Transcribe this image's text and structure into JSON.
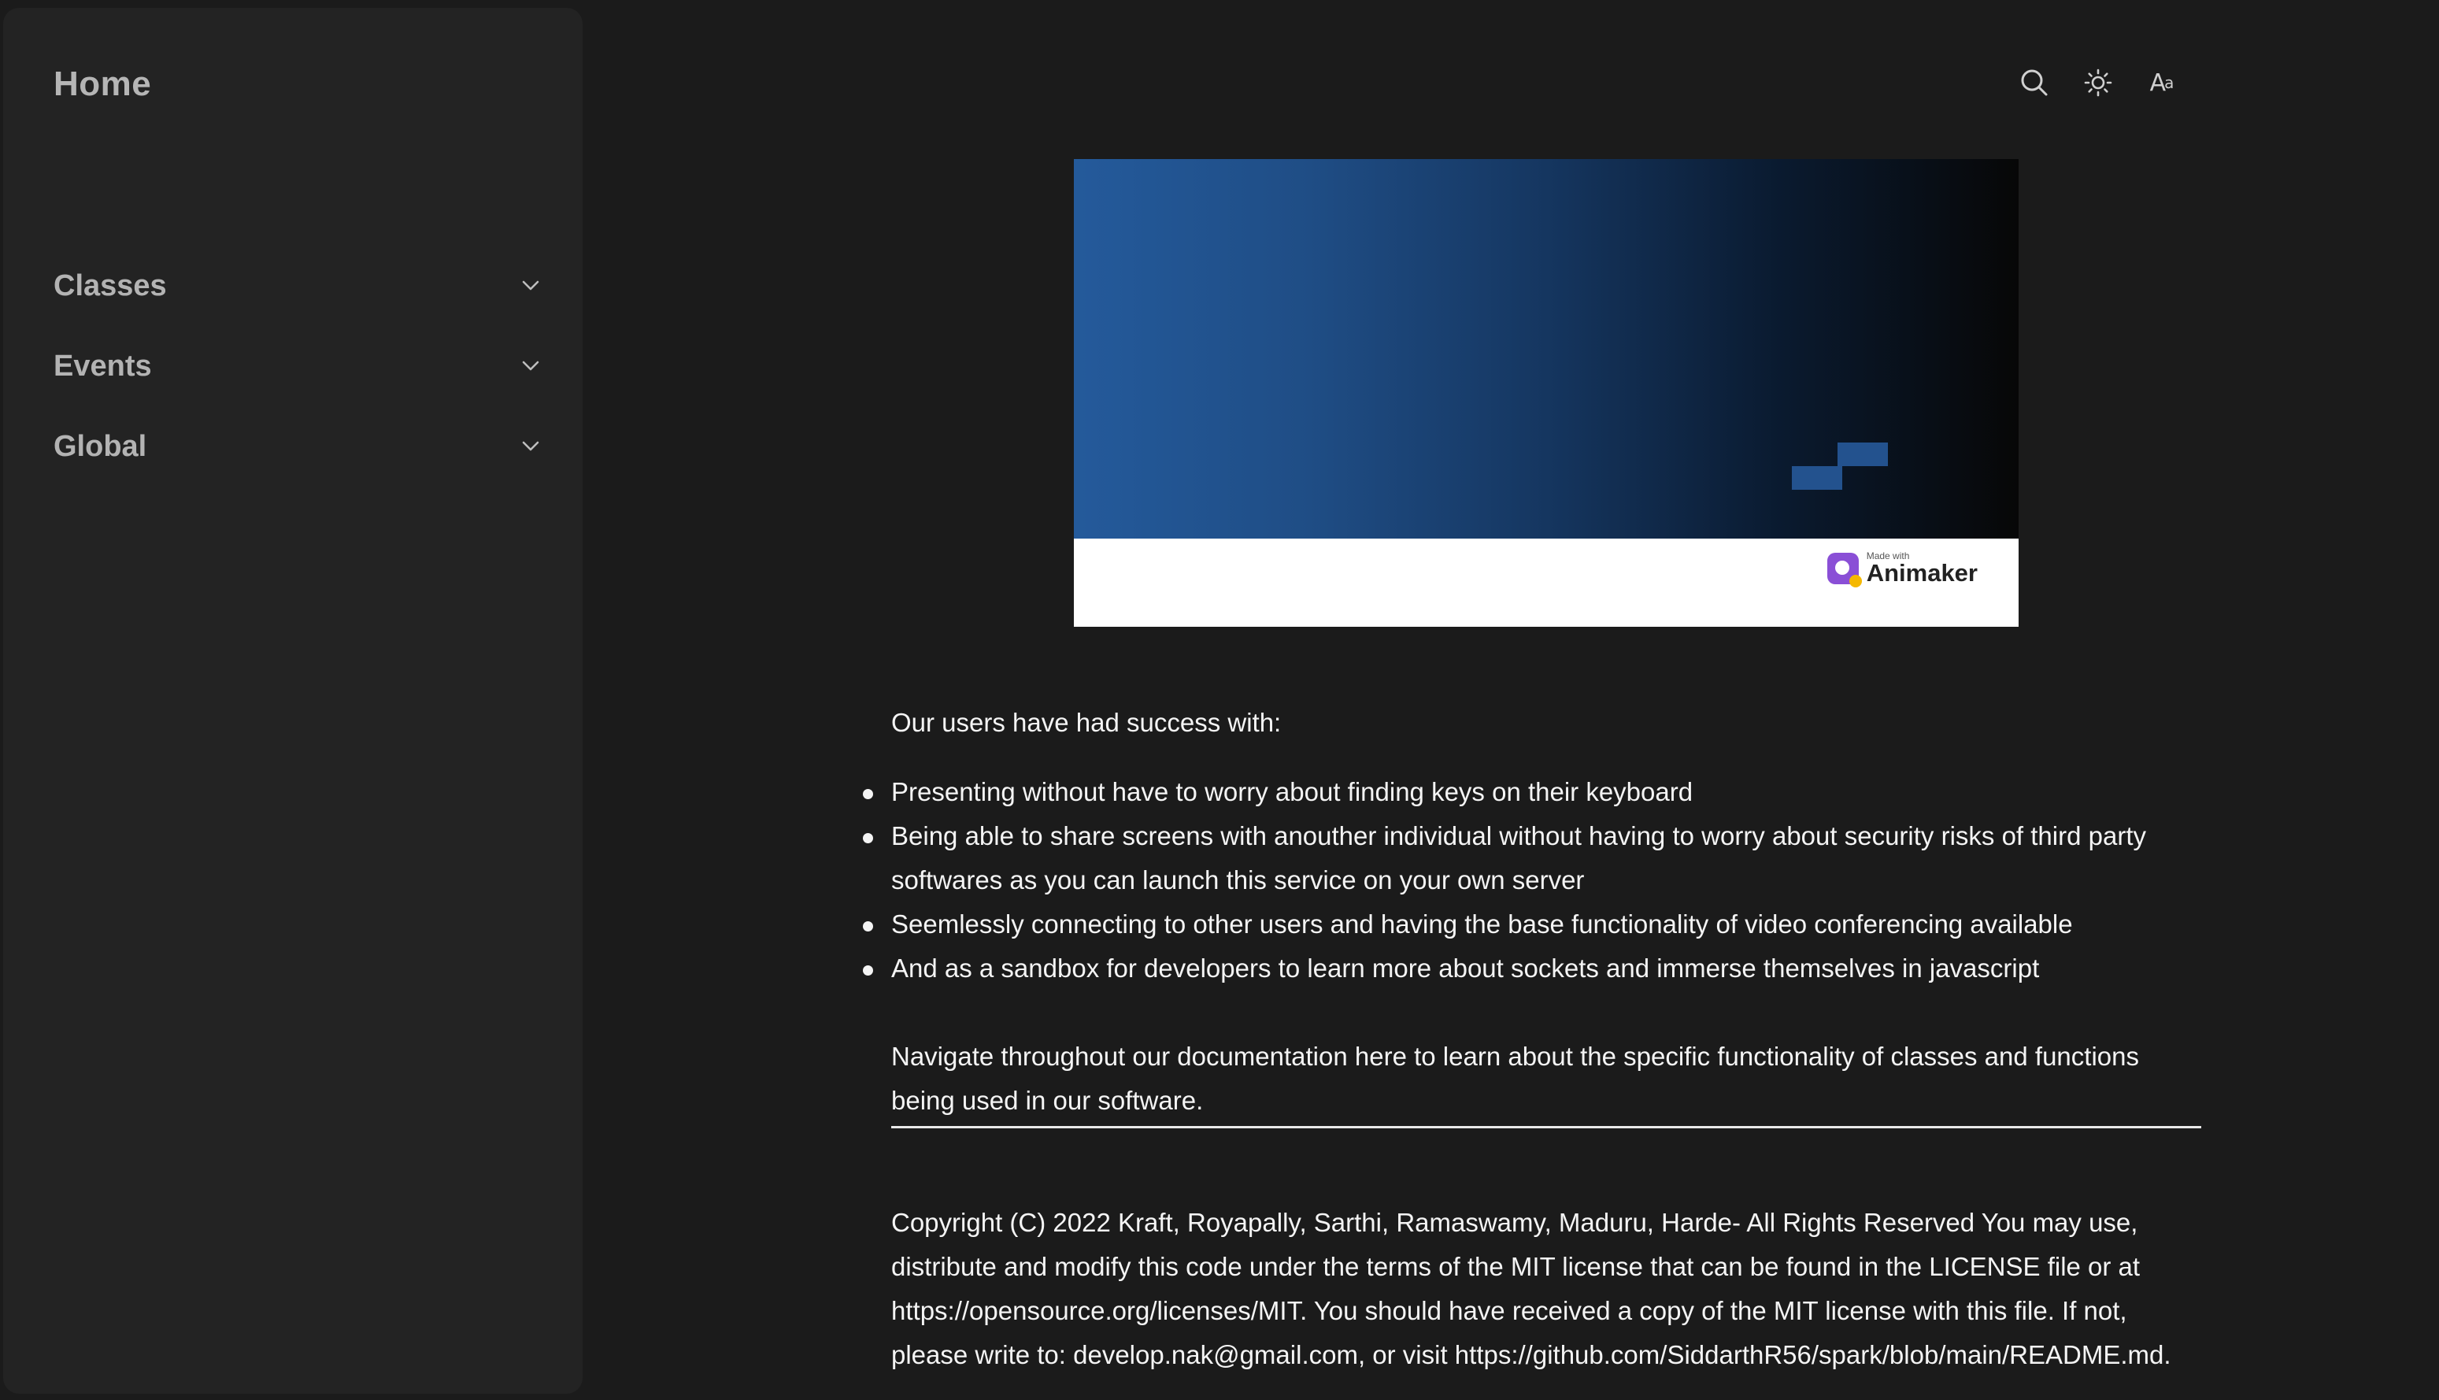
{
  "sidebar": {
    "home": "Home",
    "items": [
      {
        "label": "Classes"
      },
      {
        "label": "Events"
      },
      {
        "label": "Global"
      }
    ]
  },
  "toolbar": {
    "icons": [
      "search-icon",
      "sun-icon",
      "font-size-icon"
    ],
    "font_toggle_big": "A",
    "font_toggle_small": "a"
  },
  "banner": {
    "watermark_small": "Made with",
    "watermark_big": "Animaker",
    "gradient_colors": [
      "#245a9b",
      "#153660",
      "#070707"
    ]
  },
  "content": {
    "intro": "Our users have had success with:",
    "bullets": [
      "Presenting without have to worry about finding keys on their keyboard",
      "Being able to share screens with anouther individual without having to worry about security risks of third party softwares as you can launch this service on your own server",
      "Seemlessly connecting to other users and having the base functionality of video conferencing available",
      "And as a sandbox for developers to learn more about sockets and immerse themselves in javascript"
    ],
    "navigate": "Navigate throughout our documentation here to learn about the specific functionality of classes and functions being used in our software.",
    "copyright": "Copyright (C) 2022 Kraft, Royapally, Sarthi, Ramaswamy, Maduru, Harde- All Rights Reserved You may use, distribute and modify this code under the terms of the MIT license that can be found in the LICENSE file or at https://opensource.org/licenses/MIT. You should have received a copy of the MIT license with this file. If not, please write to: develop.nak@gmail.com, or visit https://github.com/SiddarthR56/spark/blob/main/README.md."
  }
}
